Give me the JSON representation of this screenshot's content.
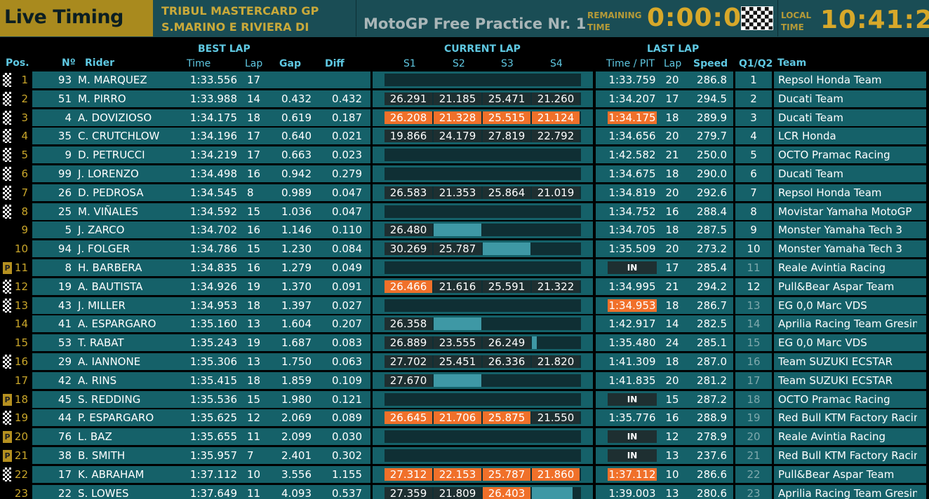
{
  "header": {
    "app_title": "Live Timing",
    "event_line1": "TRIBUL MASTERCARD GP",
    "event_line2": "S.MARINO E RIVIERA DI",
    "session": "MotoGP  Free Practice Nr. 1",
    "remaining_label_1": "REMAINING",
    "remaining_label_2": "TIME",
    "remaining_time": "0:00:00",
    "local_label_1": "LOCAL",
    "local_label_2": "TIME",
    "local_time": "10:41:20"
  },
  "columns": {
    "pos": "Pos.",
    "num": "Nº",
    "rider": "Rider",
    "best_lap": "BEST LAP",
    "time": "Time",
    "lap": "Lap",
    "gap": "Gap",
    "diff": "Diff",
    "current_lap": "CURRENT LAP",
    "s1": "S1",
    "s2": "S2",
    "s3": "S3",
    "s4": "S4",
    "last_lap": "LAST LAP",
    "time_pit": "Time / PIT",
    "last_lap_no": "Lap",
    "speed": "Speed",
    "q": "Q1/Q2",
    "team": "Team"
  },
  "colors": {
    "accent_gold": "#c9a62a",
    "row_teal": "#156169",
    "header_blue": "#5fc8e2",
    "highlight_orange": "#f0702a",
    "progress_blue": "#3e98a5"
  },
  "rows": [
    {
      "pos": "1",
      "marker": "flag",
      "num": "93",
      "rider": "M. MARQUEZ",
      "best": "1:33.556",
      "best_lap": "17",
      "gap": "",
      "diff": "",
      "s": [],
      "last": "1:33.759",
      "last_style": "n",
      "last_lap": "20",
      "speed": "286.8",
      "q": "1",
      "q_dim": false,
      "team": "Repsol Honda Team"
    },
    {
      "pos": "2",
      "marker": "flag",
      "num": "51",
      "rider": "M. PIRRO",
      "best": "1:33.988",
      "best_lap": "14",
      "gap": "0.432",
      "diff": "0.432",
      "s": [
        {
          "v": "26.291",
          "t": "n"
        },
        {
          "v": "21.185",
          "t": "n"
        },
        {
          "v": "25.471",
          "t": "n"
        },
        {
          "v": "21.260",
          "t": "n"
        }
      ],
      "last": "1:34.207",
      "last_style": "n",
      "last_lap": "17",
      "speed": "294.5",
      "q": "2",
      "q_dim": false,
      "team": "Ducati Team"
    },
    {
      "pos": "3",
      "marker": "flag",
      "num": "4",
      "rider": "A. DOVIZIOSO",
      "best": "1:34.175",
      "best_lap": "18",
      "gap": "0.619",
      "diff": "0.187",
      "s": [
        {
          "v": "26.208",
          "t": "o"
        },
        {
          "v": "21.328",
          "t": "o"
        },
        {
          "v": "25.515",
          "t": "o"
        },
        {
          "v": "21.124",
          "t": "o"
        }
      ],
      "last": "1:34.175",
      "last_style": "o",
      "last_lap": "18",
      "speed": "289.9",
      "q": "3",
      "q_dim": false,
      "team": "Ducati Team"
    },
    {
      "pos": "4",
      "marker": "flag",
      "num": "35",
      "rider": "C. CRUTCHLOW",
      "best": "1:34.196",
      "best_lap": "17",
      "gap": "0.640",
      "diff": "0.021",
      "s": [
        {
          "v": "19.866",
          "t": "n"
        },
        {
          "v": "24.179",
          "t": "n"
        },
        {
          "v": "27.819",
          "t": "n"
        },
        {
          "v": "22.792",
          "t": "n"
        }
      ],
      "last": "1:34.656",
      "last_style": "n",
      "last_lap": "20",
      "speed": "279.7",
      "q": "4",
      "q_dim": false,
      "team": "LCR Honda"
    },
    {
      "pos": "5",
      "marker": "flag",
      "num": "9",
      "rider": "D. PETRUCCI",
      "best": "1:34.219",
      "best_lap": "17",
      "gap": "0.663",
      "diff": "0.023",
      "s": [],
      "last": "1:42.582",
      "last_style": "n",
      "last_lap": "21",
      "speed": "250.0",
      "q": "5",
      "q_dim": false,
      "team": "OCTO Pramac Racing"
    },
    {
      "pos": "6",
      "marker": "flag",
      "num": "99",
      "rider": "J. LORENZO",
      "best": "1:34.498",
      "best_lap": "16",
      "gap": "0.942",
      "diff": "0.279",
      "s": [],
      "last": "1:34.675",
      "last_style": "n",
      "last_lap": "18",
      "speed": "290.0",
      "q": "6",
      "q_dim": false,
      "team": "Ducati Team"
    },
    {
      "pos": "7",
      "marker": "flag",
      "num": "26",
      "rider": "D. PEDROSA",
      "best": "1:34.545",
      "best_lap": "8",
      "gap": "0.989",
      "diff": "0.047",
      "s": [
        {
          "v": "26.583",
          "t": "n"
        },
        {
          "v": "21.353",
          "t": "n"
        },
        {
          "v": "25.864",
          "t": "n"
        },
        {
          "v": "21.019",
          "t": "n"
        }
      ],
      "last": "1:34.819",
      "last_style": "n",
      "last_lap": "20",
      "speed": "292.6",
      "q": "7",
      "q_dim": false,
      "team": "Repsol Honda Team"
    },
    {
      "pos": "8",
      "marker": "flag",
      "num": "25",
      "rider": "M. VIÑALES",
      "best": "1:34.592",
      "best_lap": "15",
      "gap": "1.036",
      "diff": "0.047",
      "s": [],
      "last": "1:34.752",
      "last_style": "n",
      "last_lap": "16",
      "speed": "288.4",
      "q": "8",
      "q_dim": false,
      "team": "Movistar Yamaha MotoGP"
    },
    {
      "pos": "9",
      "marker": "",
      "num": "5",
      "rider": "J. ZARCO",
      "best": "1:34.702",
      "best_lap": "16",
      "gap": "1.146",
      "diff": "0.110",
      "s": [
        {
          "v": "26.480",
          "t": "n"
        },
        {
          "v": "",
          "t": "p",
          "fill": 1
        }
      ],
      "last": "1:34.705",
      "last_style": "n",
      "last_lap": "18",
      "speed": "287.5",
      "q": "9",
      "q_dim": false,
      "team": "Monster Yamaha Tech 3"
    },
    {
      "pos": "10",
      "marker": "",
      "num": "94",
      "rider": "J. FOLGER",
      "best": "1:34.786",
      "best_lap": "15",
      "gap": "1.230",
      "diff": "0.084",
      "s": [
        {
          "v": "30.269",
          "t": "n"
        },
        {
          "v": "25.787",
          "t": "n"
        },
        {
          "v": "",
          "t": "p",
          "fill": 1
        }
      ],
      "last": "1:35.509",
      "last_style": "n",
      "last_lap": "20",
      "speed": "273.2",
      "q": "10",
      "q_dim": false,
      "team": "Monster Yamaha Tech 3"
    },
    {
      "pos": "11",
      "marker": "pit",
      "num": "8",
      "rider": "H. BARBERA",
      "best": "1:34.835",
      "best_lap": "16",
      "gap": "1.279",
      "diff": "0.049",
      "s": [],
      "last": "IN",
      "last_style": "in",
      "last_lap": "17",
      "speed": "285.4",
      "q": "11",
      "q_dim": true,
      "team": "Reale Avintia Racing"
    },
    {
      "pos": "12",
      "marker": "flag",
      "num": "19",
      "rider": "A. BAUTISTA",
      "best": "1:34.926",
      "best_lap": "19",
      "gap": "1.370",
      "diff": "0.091",
      "s": [
        {
          "v": "26.466",
          "t": "o"
        },
        {
          "v": "21.616",
          "t": "n"
        },
        {
          "v": "25.591",
          "t": "n"
        },
        {
          "v": "21.322",
          "t": "n"
        }
      ],
      "last": "1:34.995",
      "last_style": "n",
      "last_lap": "21",
      "speed": "294.2",
      "q": "12",
      "q_dim": false,
      "team": "Pull&Bear Aspar Team"
    },
    {
      "pos": "13",
      "marker": "flag",
      "num": "43",
      "rider": "J. MILLER",
      "best": "1:34.953",
      "best_lap": "18",
      "gap": "1.397",
      "diff": "0.027",
      "s": [],
      "last": "1:34.953",
      "last_style": "o",
      "last_lap": "18",
      "speed": "286.7",
      "q": "13",
      "q_dim": true,
      "team": "EG 0,0 Marc VDS"
    },
    {
      "pos": "14",
      "marker": "",
      "num": "41",
      "rider": "A. ESPARGARO",
      "best": "1:35.160",
      "best_lap": "13",
      "gap": "1.604",
      "diff": "0.207",
      "s": [
        {
          "v": "26.358",
          "t": "n"
        },
        {
          "v": "",
          "t": "p",
          "fill": 1
        }
      ],
      "last": "1:42.917",
      "last_style": "n",
      "last_lap": "14",
      "speed": "282.5",
      "q": "14",
      "q_dim": true,
      "team": "Aprilia Racing Team Gresini"
    },
    {
      "pos": "15",
      "marker": "",
      "num": "53",
      "rider": "T. RABAT",
      "best": "1:35.243",
      "best_lap": "19",
      "gap": "1.687",
      "diff": "0.083",
      "s": [
        {
          "v": "26.889",
          "t": "n"
        },
        {
          "v": "23.555",
          "t": "n"
        },
        {
          "v": "26.249",
          "t": "n"
        },
        {
          "v": "",
          "t": "p",
          "fill": 0.1
        }
      ],
      "last": "1:35.480",
      "last_style": "n",
      "last_lap": "24",
      "speed": "285.1",
      "q": "15",
      "q_dim": true,
      "team": "EG 0,0 Marc VDS"
    },
    {
      "pos": "16",
      "marker": "flag",
      "num": "29",
      "rider": "A. IANNONE",
      "best": "1:35.306",
      "best_lap": "13",
      "gap": "1.750",
      "diff": "0.063",
      "s": [
        {
          "v": "27.702",
          "t": "n"
        },
        {
          "v": "25.451",
          "t": "n"
        },
        {
          "v": "26.336",
          "t": "n"
        },
        {
          "v": "21.820",
          "t": "n"
        }
      ],
      "last": "1:41.309",
      "last_style": "n",
      "last_lap": "18",
      "speed": "287.0",
      "q": "16",
      "q_dim": true,
      "team": "Team SUZUKI ECSTAR"
    },
    {
      "pos": "17",
      "marker": "",
      "num": "42",
      "rider": "A. RINS",
      "best": "1:35.415",
      "best_lap": "18",
      "gap": "1.859",
      "diff": "0.109",
      "s": [
        {
          "v": "27.670",
          "t": "n"
        },
        {
          "v": "",
          "t": "p",
          "fill": 1
        }
      ],
      "last": "1:41.835",
      "last_style": "n",
      "last_lap": "20",
      "speed": "281.2",
      "q": "17",
      "q_dim": true,
      "team": "Team SUZUKI ECSTAR"
    },
    {
      "pos": "18",
      "marker": "pit",
      "num": "45",
      "rider": "S. REDDING",
      "best": "1:35.536",
      "best_lap": "15",
      "gap": "1.980",
      "diff": "0.121",
      "s": [],
      "last": "IN",
      "last_style": "in",
      "last_lap": "15",
      "speed": "287.2",
      "q": "18",
      "q_dim": true,
      "team": "OCTO Pramac Racing"
    },
    {
      "pos": "19",
      "marker": "flag",
      "num": "44",
      "rider": "P. ESPARGARO",
      "best": "1:35.625",
      "best_lap": "12",
      "gap": "2.069",
      "diff": "0.089",
      "s": [
        {
          "v": "26.645",
          "t": "o"
        },
        {
          "v": "21.706",
          "t": "o"
        },
        {
          "v": "25.875",
          "t": "o"
        },
        {
          "v": "21.550",
          "t": "n"
        }
      ],
      "last": "1:35.776",
      "last_style": "n",
      "last_lap": "16",
      "speed": "288.9",
      "q": "19",
      "q_dim": true,
      "team": "Red Bull KTM Factory Racing"
    },
    {
      "pos": "20",
      "marker": "pit",
      "num": "76",
      "rider": "L. BAZ",
      "best": "1:35.655",
      "best_lap": "11",
      "gap": "2.099",
      "diff": "0.030",
      "s": [],
      "last": "IN",
      "last_style": "in",
      "last_lap": "12",
      "speed": "278.9",
      "q": "20",
      "q_dim": true,
      "team": "Reale Avintia Racing"
    },
    {
      "pos": "21",
      "marker": "pit",
      "num": "38",
      "rider": "B. SMITH",
      "best": "1:35.957",
      "best_lap": "7",
      "gap": "2.401",
      "diff": "0.302",
      "s": [],
      "last": "IN",
      "last_style": "in",
      "last_lap": "13",
      "speed": "237.6",
      "q": "21",
      "q_dim": true,
      "team": "Red Bull KTM Factory Racing"
    },
    {
      "pos": "22",
      "marker": "flag",
      "num": "17",
      "rider": "K. ABRAHAM",
      "best": "1:37.112",
      "best_lap": "10",
      "gap": "3.556",
      "diff": "1.155",
      "s": [
        {
          "v": "27.312",
          "t": "o"
        },
        {
          "v": "22.153",
          "t": "o"
        },
        {
          "v": "25.787",
          "t": "o"
        },
        {
          "v": "21.860",
          "t": "o"
        }
      ],
      "last": "1:37.112",
      "last_style": "o",
      "last_lap": "10",
      "speed": "286.6",
      "q": "22",
      "q_dim": true,
      "team": "Pull&Bear Aspar Team"
    },
    {
      "pos": "23",
      "marker": "",
      "num": "22",
      "rider": "S. LOWES",
      "best": "1:37.649",
      "best_lap": "11",
      "gap": "4.093",
      "diff": "0.537",
      "s": [
        {
          "v": "27.359",
          "t": "n"
        },
        {
          "v": "21.809",
          "t": "n"
        },
        {
          "v": "26.403",
          "t": "o"
        },
        {
          "v": "",
          "t": "p",
          "fill": 0.85
        }
      ],
      "last": "1:39.003",
      "last_style": "n",
      "last_lap": "13",
      "speed": "280.6",
      "q": "23",
      "q_dim": true,
      "team": "Aprilia Racing Team Gresini"
    }
  ]
}
